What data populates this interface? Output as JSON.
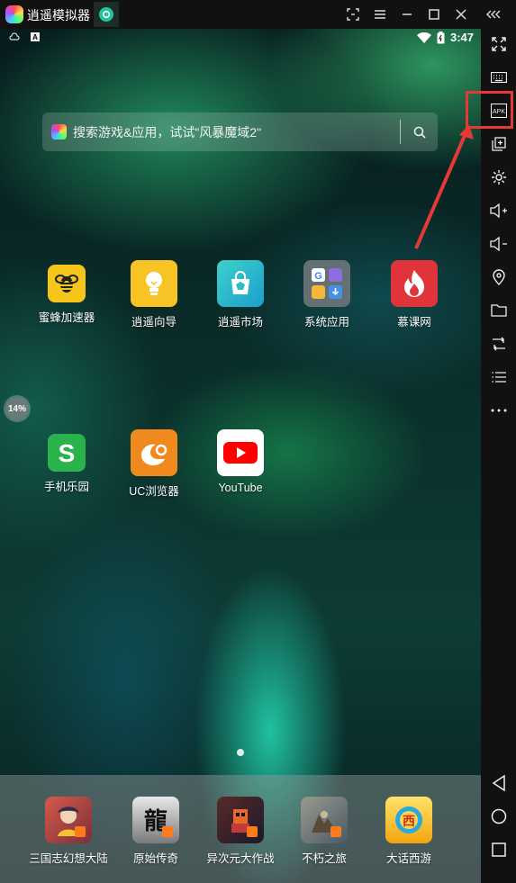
{
  "titlebar": {
    "title": "逍遥模拟器",
    "icons": [
      "app-logo-icon",
      "android-tab-icon",
      "screenshot-icon",
      "menu-icon",
      "minimize-icon",
      "maximize-icon",
      "close-icon",
      "collapse-sidebar-icon"
    ]
  },
  "statusbar": {
    "time": "3:47",
    "left_icons": [
      "cloud-icon",
      "notification-a-icon"
    ],
    "right_icons": [
      "wifi-icon",
      "battery-icon"
    ]
  },
  "search": {
    "placeholder": "搜索游戏&应用，试试\"风暴魔域2\"",
    "button_icon": "search-icon"
  },
  "apps_row1": [
    {
      "label": "蜜蜂加速器",
      "icon": "bee-icon",
      "color": "#f6c51a"
    },
    {
      "label": "逍遥向导",
      "icon": "lightbulb-icon",
      "color": "#f7c325"
    },
    {
      "label": "逍遥市场",
      "icon": "market-bag-icon",
      "color": "#2bbfc4"
    },
    {
      "label": "系统应用",
      "icon": "folder-icon",
      "color": "#6f7478"
    },
    {
      "label": "慕课网",
      "icon": "flame-icon",
      "color": "#e0333a"
    }
  ],
  "apps_row2": [
    {
      "label": "手机乐园",
      "icon": "s-logo-icon",
      "color": "#29b34a"
    },
    {
      "label": "UC浏览器",
      "icon": "uc-squirrel-icon",
      "color": "#f08a1e"
    },
    {
      "label": "YouTube",
      "icon": "youtube-play-icon",
      "color": "#ffffff"
    }
  ],
  "progress_badge": "14%",
  "dock": [
    {
      "label": "三国志幻想大陆",
      "icon": "game-sanguo-icon",
      "color": "#b43a3a"
    },
    {
      "label": "原始传奇",
      "icon": "game-yuanshi-icon",
      "color": "#3a3a3a"
    },
    {
      "label": "异次元大作战",
      "icon": "game-yiciyuan-icon",
      "color": "#4a2a2a"
    },
    {
      "label": "不朽之旅",
      "icon": "game-buxiu-icon",
      "color": "#6a6a5a"
    },
    {
      "label": "大话西游",
      "icon": "game-dahua-icon",
      "color": "#f2c230"
    }
  ],
  "toolbar_icons": [
    "fullscreen-icon",
    "keyboard-icon",
    "apk-install-icon",
    "multi-instance-icon",
    "settings-gear-icon",
    "volume-up-icon",
    "volume-down-icon",
    "location-icon",
    "folder-icon",
    "rotate-icon",
    "list-icon",
    "more-icon"
  ],
  "nav_icons": [
    "back-icon",
    "home-icon",
    "recents-icon"
  ],
  "annotation_color": "#e53935"
}
